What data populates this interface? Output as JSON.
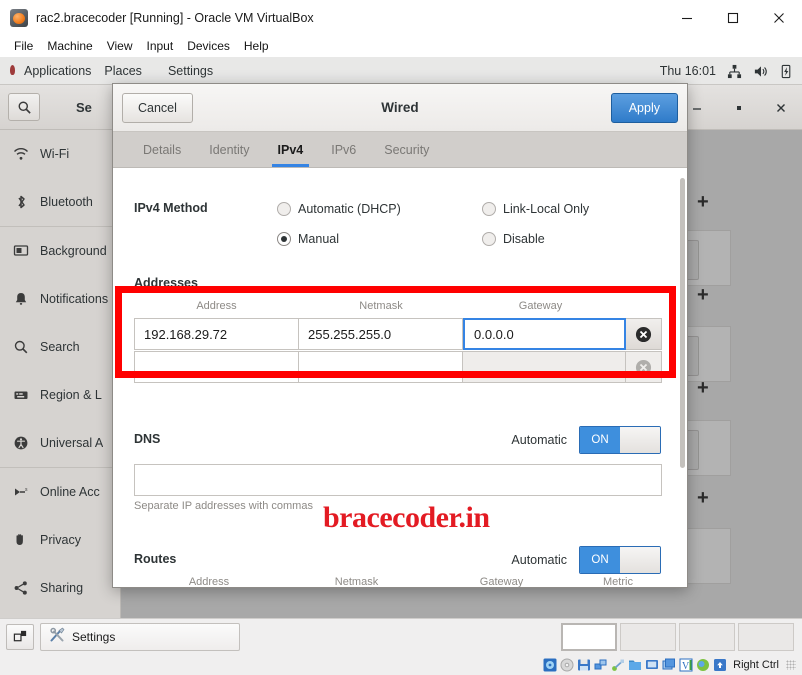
{
  "host_window": {
    "title": "rac2.bracecoder [Running] - Oracle VM VirtualBox",
    "icon": "virtualbox-icon",
    "menu": [
      "File",
      "Machine",
      "View",
      "Input",
      "Devices",
      "Help"
    ],
    "controls": {
      "minimize": "minimize-icon",
      "maximize": "maximize-icon",
      "close": "close-icon"
    }
  },
  "gnome_topbar": {
    "activities": "Applications",
    "places": "Places",
    "app": "Settings",
    "clock": "Thu 16:01",
    "indicators": [
      "network-icon",
      "volume-icon",
      "battery-icon"
    ]
  },
  "settings_window": {
    "search_icon": "search-icon",
    "title": "Se",
    "window_controls": {
      "minimize": "minimize-icon",
      "maximize": "maximize-icon",
      "close": "close-icon"
    },
    "sidebar": [
      {
        "label": "Wi-Fi",
        "icon": "wifi-icon"
      },
      {
        "label": "Bluetooth",
        "icon": "bluetooth-icon"
      },
      {
        "label": "Background",
        "icon": "background-icon"
      },
      {
        "label": "Notifications",
        "icon": "bell-icon"
      },
      {
        "label": "Search",
        "icon": "search-icon"
      },
      {
        "label": "Region & L",
        "icon": "keyboard-icon"
      },
      {
        "label": "Universal A",
        "icon": "accessibility-icon"
      },
      {
        "label": "Online Acc",
        "icon": "online-accounts-icon"
      },
      {
        "label": "Privacy",
        "icon": "privacy-hand-icon"
      },
      {
        "label": "Sharing",
        "icon": "share-icon"
      }
    ],
    "add_button": "+"
  },
  "dialog": {
    "title": "Wired",
    "cancel_label": "Cancel",
    "apply_label": "Apply",
    "tabs": [
      {
        "label": "Details",
        "active": false
      },
      {
        "label": "Identity",
        "active": false
      },
      {
        "label": "IPv4",
        "active": true
      },
      {
        "label": "IPv6",
        "active": false
      },
      {
        "label": "Security",
        "active": false
      }
    ],
    "ipv4_method": {
      "label": "IPv4 Method",
      "options": [
        {
          "label": "Automatic (DHCP)",
          "selected": false
        },
        {
          "label": "Link-Local Only",
          "selected": false
        },
        {
          "label": "Manual",
          "selected": true
        },
        {
          "label": "Disable",
          "selected": false
        }
      ]
    },
    "addresses": {
      "label": "Addresses",
      "columns": [
        "Address",
        "Netmask",
        "Gateway"
      ],
      "rows": [
        {
          "address": "192.168.29.72",
          "netmask": "255.255.255.0",
          "gateway": "0.0.0.0",
          "gateway_focused": true
        },
        {
          "address": "",
          "netmask": "",
          "gateway": "",
          "gateway_focused": false
        }
      ],
      "delete_icon": "delete-circle-icon"
    },
    "dns": {
      "label": "DNS",
      "automatic_label": "Automatic",
      "toggle_state": "ON",
      "value": "",
      "hint": "Separate IP addresses with commas"
    },
    "routes": {
      "label": "Routes",
      "automatic_label": "Automatic",
      "toggle_state": "ON",
      "columns": [
        "Address",
        "Netmask",
        "Gateway",
        "Metric"
      ],
      "rows": [
        {
          "address": "",
          "netmask": "",
          "gateway": "",
          "metric": ""
        }
      ],
      "delete_icon": "delete-circle-icon"
    }
  },
  "watermark": {
    "text": "bracecoder.in",
    "color": "#e31b23"
  },
  "highlight": {
    "color": "#ff0000",
    "target": "addresses-row"
  },
  "taskbar": {
    "system_icon": "restore-windows-icon",
    "window_button": {
      "label": "Settings",
      "icon": "settings-tools-icon"
    }
  },
  "statusbar": {
    "icons": [
      "hard-disk-icon",
      "optical-disk-icon",
      "floppy-icon",
      "network-icon",
      "usb-icon",
      "shared-folder-icon",
      "display-icon",
      "recording-icon",
      "virtualization-icon",
      "mouse-icon",
      "keyboard-icon"
    ],
    "host_key": "Right Ctrl"
  },
  "colors": {
    "accent": "#3584e4",
    "apply_button": "#2f7bc9",
    "toggle_on": "#3e8fdd",
    "highlight_red": "#ff0000"
  }
}
